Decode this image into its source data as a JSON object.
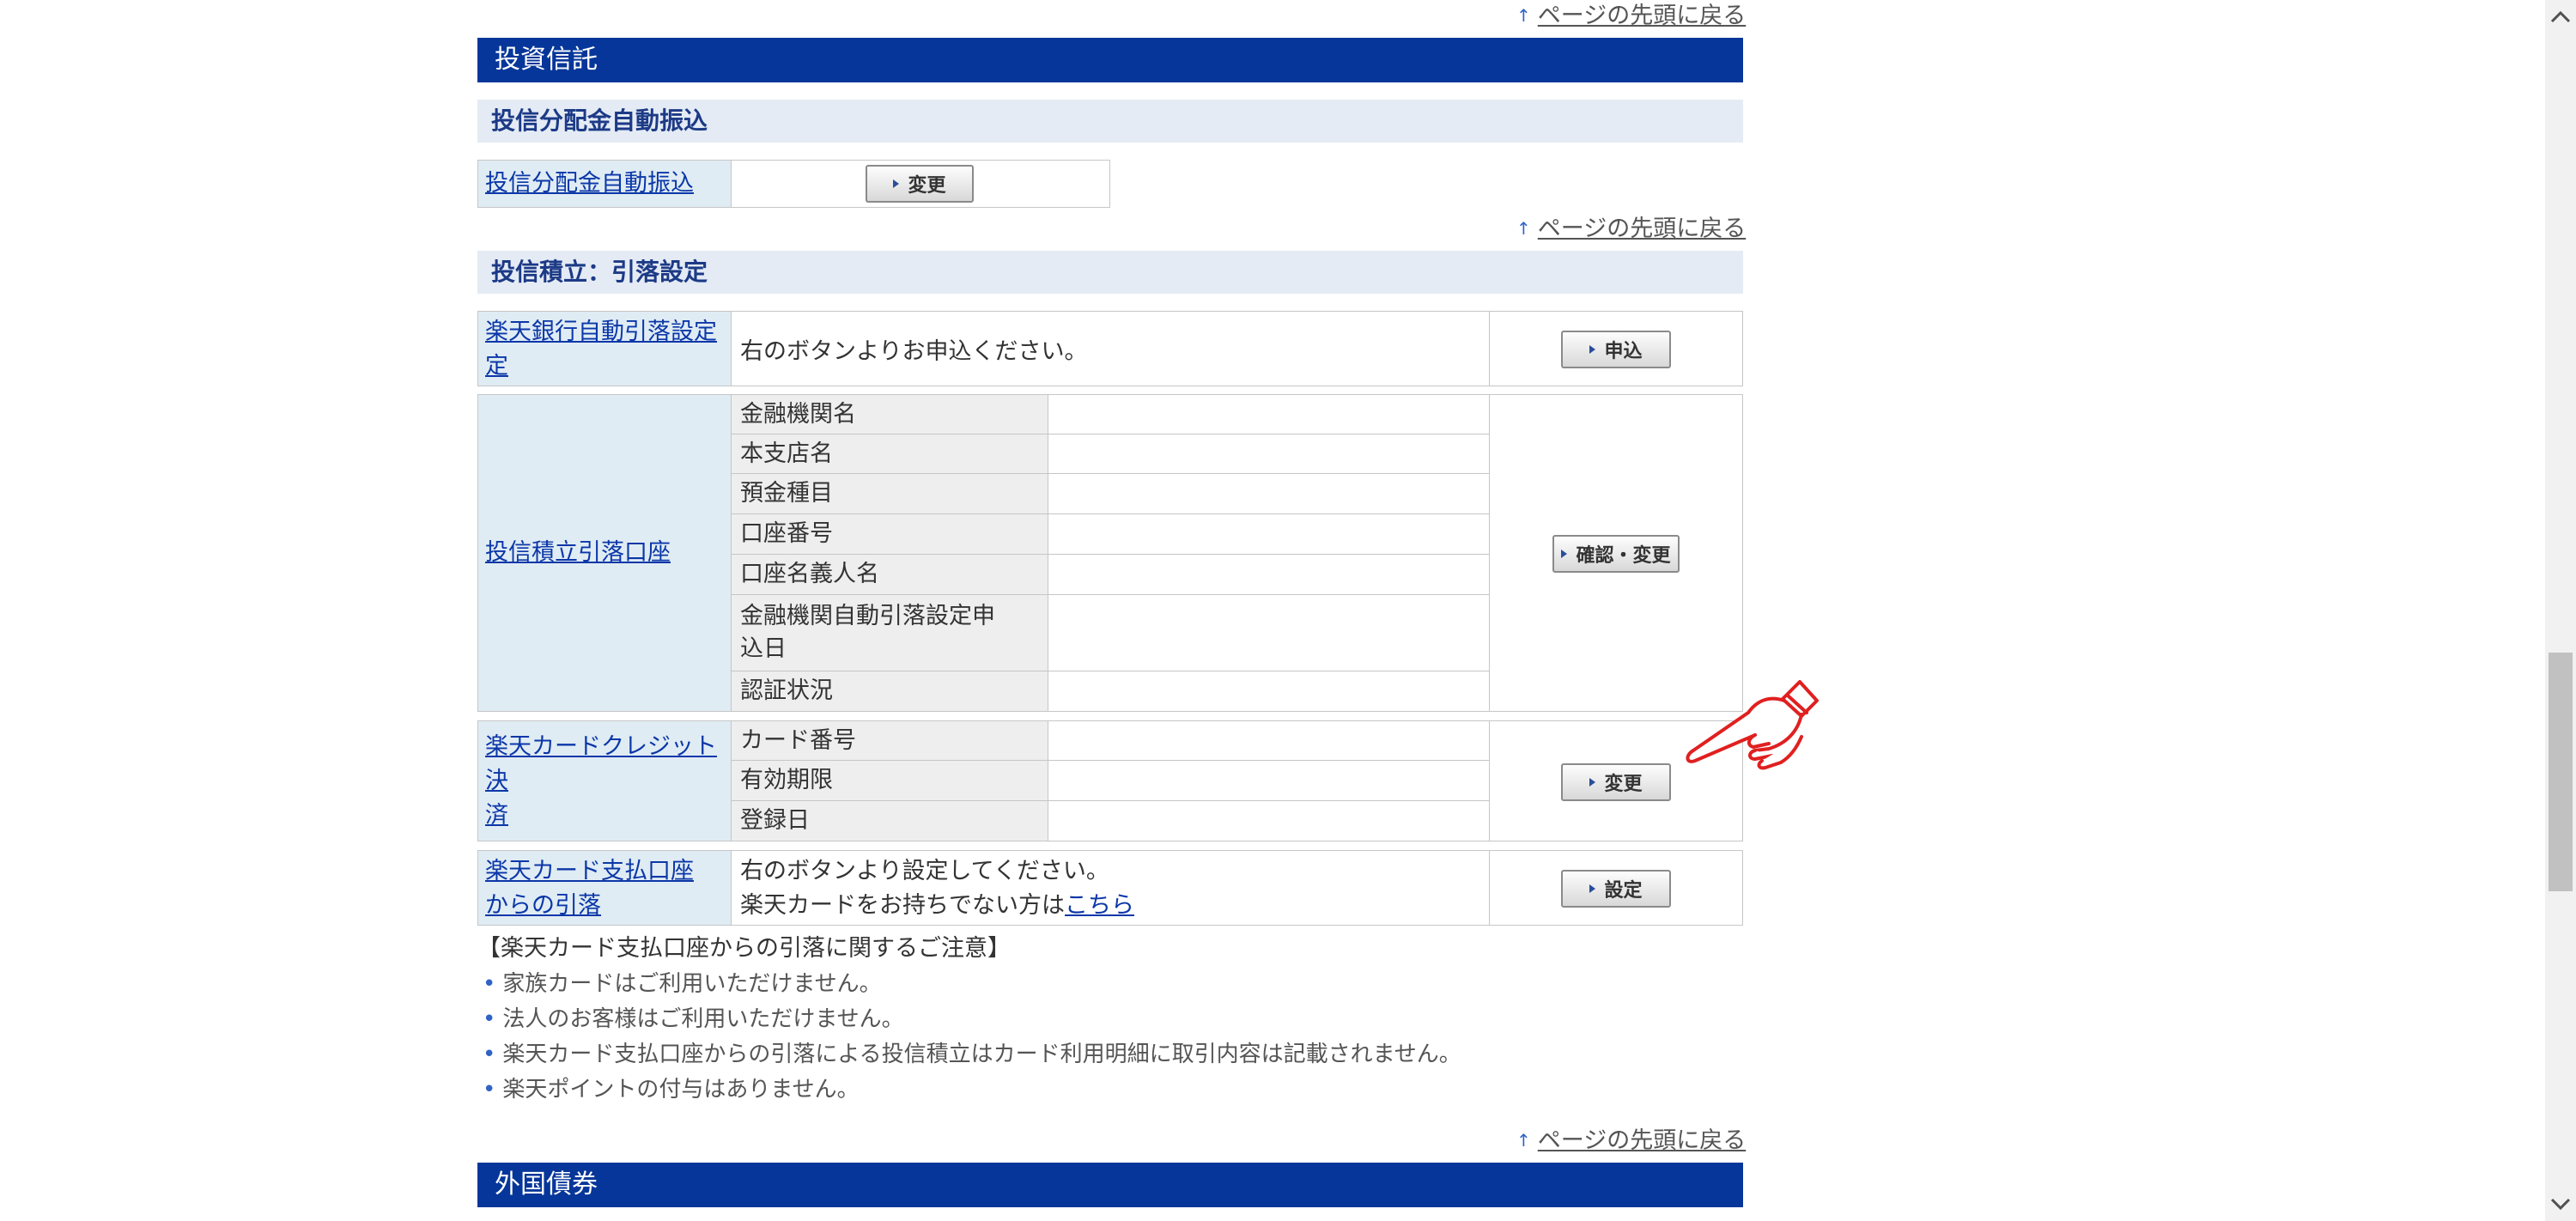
{
  "nav": {
    "back_to_top": "ページの先頭に戻る"
  },
  "sections": {
    "investment_trust": "投資信託",
    "foreign_bonds": "外国債券"
  },
  "distribution": {
    "header": "投信分配金自動振込",
    "link": "投信分配金自動振込",
    "button": "変更"
  },
  "tsumitate": {
    "header": "投信積立：引落設定",
    "bank": {
      "link": "楽天銀行自動引落設定",
      "link_line2": "定",
      "text": "右のボタンよりお申込ください。",
      "button": "申込"
    },
    "account": {
      "link": "投信積立引落口座",
      "fields": [
        "金融機関名",
        "本支店名",
        "預金種目",
        "口座番号",
        "口座名義人名",
        "金融機関自動引落設定申",
        "込日",
        "認証状況"
      ],
      "button": "確認・変更"
    },
    "card": {
      "link_line1": "楽天カードクレジット決",
      "link_line2": "済",
      "fields": [
        "カード番号",
        "有効期限",
        "登録日"
      ],
      "button": "変更"
    },
    "card_account": {
      "link_line1": "楽天カード支払口座",
      "link_line2": "からの引落",
      "text_line1": "右のボタンより設定してください。",
      "text_line2": "楽天カードをお持ちでない方は",
      "here_link": "こちら",
      "button": "設定"
    }
  },
  "notes": {
    "title": "【楽天カード支払口座からの引落に関するご注意】",
    "items": [
      "家族カードはご利用いただけません。",
      "法人のお客様はご利用いただけません。",
      "楽天カード支払口座からの引落による投信積立はカード利用明細に取引内容は記載されません。",
      "楽天ポイントの付与はありません。"
    ]
  },
  "colors": {
    "section_bar": "#063699",
    "sub_bar": "#e4ebf5",
    "label_cell": "#e0ecf4",
    "field_cell": "#eeeeee",
    "link": "#0b37a8",
    "pointer_hand": "#e02020"
  },
  "icons": [
    "up-arrow-icon",
    "triangle-right-icon",
    "pointing-hand-icon",
    "scroll-up-icon",
    "scroll-down-icon"
  ]
}
